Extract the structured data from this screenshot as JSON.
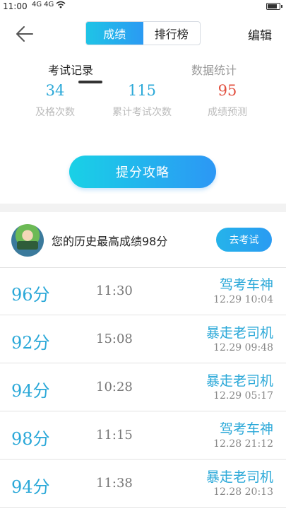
{
  "status_bar": {
    "time": "11:00",
    "signal_labels": [
      "4G",
      "4G"
    ]
  },
  "header": {
    "segment_tabs": [
      {
        "label": "成绩",
        "active": true
      },
      {
        "label": "排行榜",
        "active": false
      }
    ],
    "edit_label": "编辑"
  },
  "tabs": [
    {
      "label": "考试记录",
      "active": true
    },
    {
      "label": "数据统计",
      "active": false
    }
  ],
  "stats": [
    {
      "value": "34",
      "label": "及格次数",
      "color": "#2aa8d8"
    },
    {
      "value": "115",
      "label": "累计考试次数",
      "color": "#2aa8d8"
    },
    {
      "value": "95",
      "label": "成绩预测",
      "color": "#e2503f"
    }
  ],
  "tips_button": "提分攻略",
  "profile": {
    "best_text": "您的历史最高成绩98分",
    "go_button": "去考试"
  },
  "records": [
    {
      "score": "96分",
      "duration": "11:30",
      "rank": "驾考车神",
      "date": "12.29  10:04"
    },
    {
      "score": "92分",
      "duration": "15:08",
      "rank": "暴走老司机",
      "date": "12.29  09:48"
    },
    {
      "score": "94分",
      "duration": "10:28",
      "rank": "暴走老司机",
      "date": "12.29  05:17"
    },
    {
      "score": "98分",
      "duration": "11:15",
      "rank": "驾考车神",
      "date": "12.28  21:12"
    },
    {
      "score": "94分",
      "duration": "11:38",
      "rank": "暴走老司机",
      "date": "12.28  20:13"
    }
  ]
}
